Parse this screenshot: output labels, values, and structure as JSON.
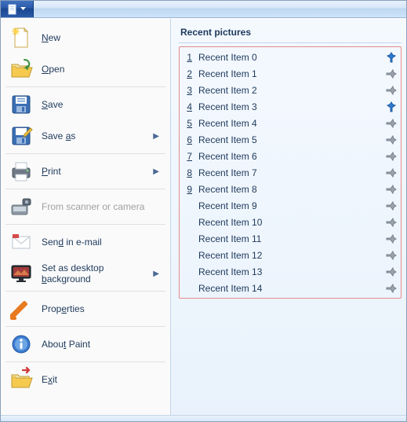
{
  "titlebar": {
    "app_icon": "document-icon"
  },
  "menu": {
    "items": [
      {
        "id": "new",
        "label_pre": "",
        "accel": "N",
        "label_post": "ew",
        "icon": "new",
        "submenu": false,
        "disabled": false
      },
      {
        "id": "open",
        "label_pre": "",
        "accel": "O",
        "label_post": "pen",
        "icon": "open",
        "submenu": false,
        "disabled": false
      },
      {
        "id": "save",
        "label_pre": "",
        "accel": "S",
        "label_post": "ave",
        "icon": "save",
        "submenu": false,
        "disabled": false
      },
      {
        "id": "saveas",
        "label_pre": "Save ",
        "accel": "a",
        "label_post": "s",
        "icon": "saveas",
        "submenu": true,
        "disabled": false
      },
      {
        "id": "print",
        "label_pre": "",
        "accel": "P",
        "label_post": "rint",
        "icon": "print",
        "submenu": true,
        "disabled": false
      },
      {
        "id": "scanner",
        "label_pre": "From scanner or camera",
        "accel": "",
        "label_post": "",
        "icon": "scanner",
        "submenu": false,
        "disabled": true
      },
      {
        "id": "email",
        "label_pre": "Sen",
        "accel": "d",
        "label_post": " in e-mail",
        "icon": "email",
        "submenu": false,
        "disabled": false
      },
      {
        "id": "wallpaper",
        "label_pre": "Set as desktop ",
        "accel": "b",
        "label_post": "ackground",
        "icon": "wallpaper",
        "submenu": true,
        "disabled": false
      },
      {
        "id": "properties",
        "label_pre": "Prop",
        "accel": "e",
        "label_post": "rties",
        "icon": "properties",
        "submenu": false,
        "disabled": false
      },
      {
        "id": "about",
        "label_pre": "Abou",
        "accel": "t",
        "label_post": " Paint",
        "icon": "about",
        "submenu": false,
        "disabled": false
      },
      {
        "id": "exit",
        "label_pre": "E",
        "accel": "x",
        "label_post": "it",
        "icon": "exit",
        "submenu": false,
        "disabled": false
      }
    ]
  },
  "recent": {
    "header": "Recent pictures",
    "items": [
      {
        "num": "1",
        "label": "Recent Item 0",
        "pinned": true
      },
      {
        "num": "2",
        "label": "Recent Item 1",
        "pinned": false
      },
      {
        "num": "3",
        "label": "Recent Item 2",
        "pinned": false
      },
      {
        "num": "4",
        "label": "Recent Item 3",
        "pinned": true
      },
      {
        "num": "5",
        "label": "Recent Item 4",
        "pinned": false
      },
      {
        "num": "6",
        "label": "Recent Item 5",
        "pinned": false
      },
      {
        "num": "7",
        "label": "Recent Item 6",
        "pinned": false
      },
      {
        "num": "8",
        "label": "Recent Item 7",
        "pinned": false
      },
      {
        "num": "9",
        "label": "Recent Item 8",
        "pinned": false
      },
      {
        "num": "",
        "label": "Recent Item 9",
        "pinned": false
      },
      {
        "num": "",
        "label": "Recent Item 10",
        "pinned": false
      },
      {
        "num": "",
        "label": "Recent Item 11",
        "pinned": false
      },
      {
        "num": "",
        "label": "Recent Item 12",
        "pinned": false
      },
      {
        "num": "",
        "label": "Recent Item 13",
        "pinned": false
      },
      {
        "num": "",
        "label": "Recent Item 14",
        "pinned": false
      }
    ]
  }
}
